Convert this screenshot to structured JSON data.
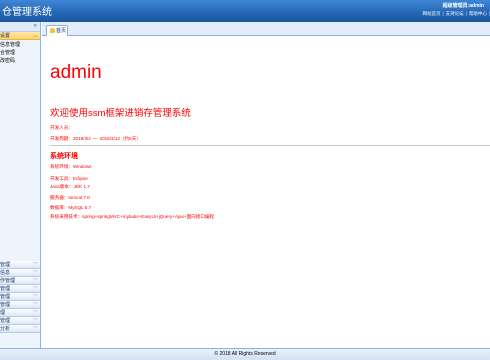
{
  "header": {
    "title": "仓管理系统",
    "welcome_prefix": "超级管理员:",
    "username": "admin",
    "links": [
      "网站首页",
      "支持论坛",
      "帮助中心"
    ]
  },
  "sidebar": {
    "active_group": {
      "label": "设置",
      "items": [
        "信息管理",
        "合管理",
        "改密码"
      ]
    },
    "groups": [
      "管理",
      "信息",
      "作管理",
      "管理",
      "管理",
      "管理",
      "理",
      "管理",
      "分析"
    ]
  },
  "tabs": [
    {
      "label": "首页"
    }
  ],
  "main": {
    "big_title": "admin",
    "welcome_title": "欢迎使用ssm框架进销存管理系统",
    "developer": "开发人员：",
    "dev_period": "开发周期：2018/3/4 ---- 2018/3/12（约8天）",
    "env_title": "系统环境",
    "env_items": [
      "系统环境：Windows",
      "开发工具：Eclipse",
      "Java版本：JDK 1.7",
      "服务器：tomcat 7.0",
      "数据库：MySQL 5.7",
      "系统采用技术：spring+springMVC+mybatis+EasyUI+jQuery+Ajax+面向接口编程"
    ]
  },
  "footer": {
    "text": "© 2018  All Rights Reserved"
  },
  "colors": {
    "header_blue": "#2566b4",
    "accent_red": "#ff0000",
    "active_group": "#ffd36a"
  }
}
